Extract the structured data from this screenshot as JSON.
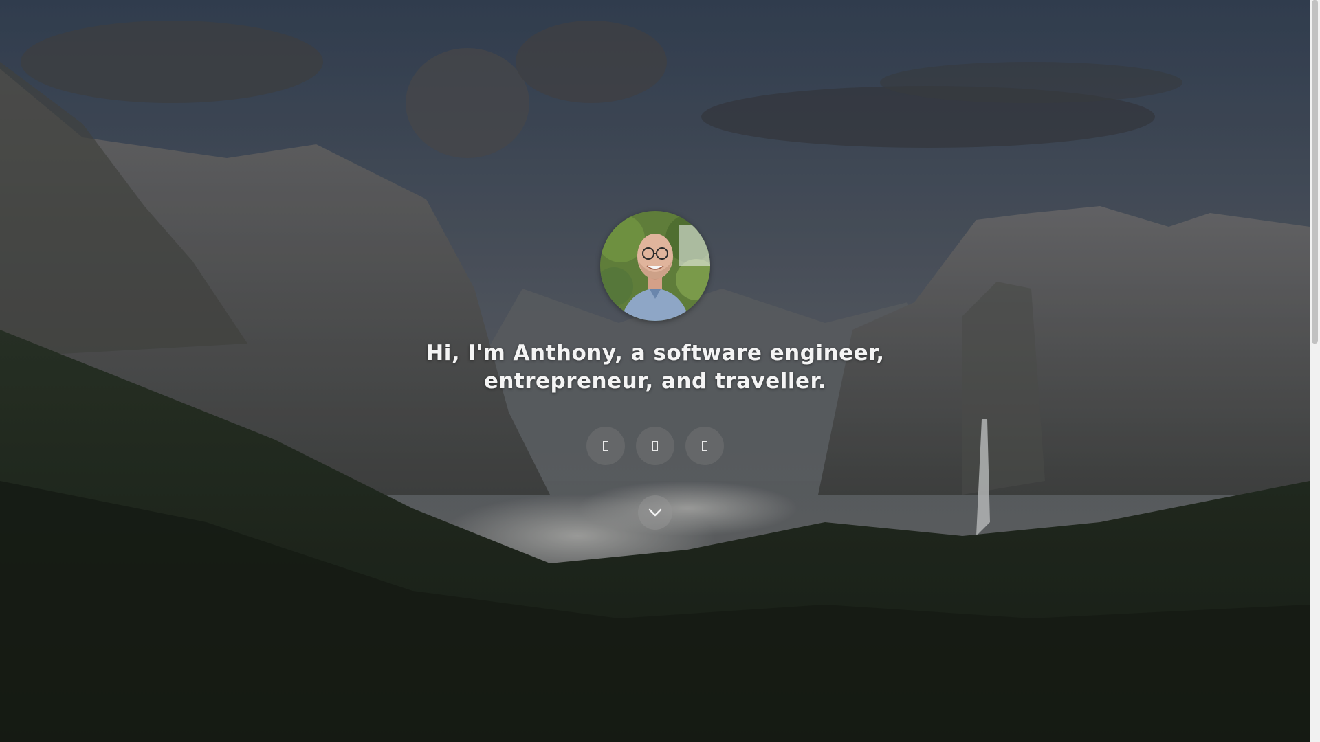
{
  "hero": {
    "headline_line1": "Hi, I'm Anthony, a software engineer,",
    "headline_line2": "entrepreneur, and traveller.",
    "avatar_icon": "profile-photo",
    "social_links": [
      {
        "icon": "social-icon-1"
      },
      {
        "icon": "social-icon-2"
      },
      {
        "icon": "social-icon-3"
      }
    ],
    "scroll_icon": "chevron-down-icon"
  },
  "colors": {
    "headline": "#f4f4f4",
    "button_bg": "rgba(120,120,120,0.45)"
  }
}
